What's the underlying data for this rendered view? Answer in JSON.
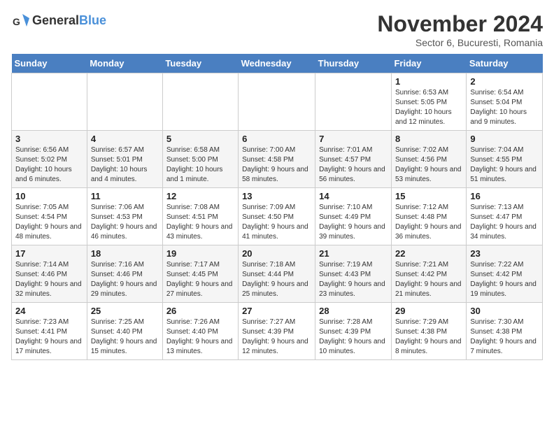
{
  "logo": {
    "line1": "General",
    "line2": "Blue"
  },
  "title": "November 2024",
  "subtitle": "Sector 6, Bucuresti, Romania",
  "days_of_week": [
    "Sunday",
    "Monday",
    "Tuesday",
    "Wednesday",
    "Thursday",
    "Friday",
    "Saturday"
  ],
  "weeks": [
    [
      {
        "day": "",
        "info": ""
      },
      {
        "day": "",
        "info": ""
      },
      {
        "day": "",
        "info": ""
      },
      {
        "day": "",
        "info": ""
      },
      {
        "day": "",
        "info": ""
      },
      {
        "day": "1",
        "info": "Sunrise: 6:53 AM\nSunset: 5:05 PM\nDaylight: 10 hours and 12 minutes."
      },
      {
        "day": "2",
        "info": "Sunrise: 6:54 AM\nSunset: 5:04 PM\nDaylight: 10 hours and 9 minutes."
      }
    ],
    [
      {
        "day": "3",
        "info": "Sunrise: 6:56 AM\nSunset: 5:02 PM\nDaylight: 10 hours and 6 minutes."
      },
      {
        "day": "4",
        "info": "Sunrise: 6:57 AM\nSunset: 5:01 PM\nDaylight: 10 hours and 4 minutes."
      },
      {
        "day": "5",
        "info": "Sunrise: 6:58 AM\nSunset: 5:00 PM\nDaylight: 10 hours and 1 minute."
      },
      {
        "day": "6",
        "info": "Sunrise: 7:00 AM\nSunset: 4:58 PM\nDaylight: 9 hours and 58 minutes."
      },
      {
        "day": "7",
        "info": "Sunrise: 7:01 AM\nSunset: 4:57 PM\nDaylight: 9 hours and 56 minutes."
      },
      {
        "day": "8",
        "info": "Sunrise: 7:02 AM\nSunset: 4:56 PM\nDaylight: 9 hours and 53 minutes."
      },
      {
        "day": "9",
        "info": "Sunrise: 7:04 AM\nSunset: 4:55 PM\nDaylight: 9 hours and 51 minutes."
      }
    ],
    [
      {
        "day": "10",
        "info": "Sunrise: 7:05 AM\nSunset: 4:54 PM\nDaylight: 9 hours and 48 minutes."
      },
      {
        "day": "11",
        "info": "Sunrise: 7:06 AM\nSunset: 4:53 PM\nDaylight: 9 hours and 46 minutes."
      },
      {
        "day": "12",
        "info": "Sunrise: 7:08 AM\nSunset: 4:51 PM\nDaylight: 9 hours and 43 minutes."
      },
      {
        "day": "13",
        "info": "Sunrise: 7:09 AM\nSunset: 4:50 PM\nDaylight: 9 hours and 41 minutes."
      },
      {
        "day": "14",
        "info": "Sunrise: 7:10 AM\nSunset: 4:49 PM\nDaylight: 9 hours and 39 minutes."
      },
      {
        "day": "15",
        "info": "Sunrise: 7:12 AM\nSunset: 4:48 PM\nDaylight: 9 hours and 36 minutes."
      },
      {
        "day": "16",
        "info": "Sunrise: 7:13 AM\nSunset: 4:47 PM\nDaylight: 9 hours and 34 minutes."
      }
    ],
    [
      {
        "day": "17",
        "info": "Sunrise: 7:14 AM\nSunset: 4:46 PM\nDaylight: 9 hours and 32 minutes."
      },
      {
        "day": "18",
        "info": "Sunrise: 7:16 AM\nSunset: 4:46 PM\nDaylight: 9 hours and 29 minutes."
      },
      {
        "day": "19",
        "info": "Sunrise: 7:17 AM\nSunset: 4:45 PM\nDaylight: 9 hours and 27 minutes."
      },
      {
        "day": "20",
        "info": "Sunrise: 7:18 AM\nSunset: 4:44 PM\nDaylight: 9 hours and 25 minutes."
      },
      {
        "day": "21",
        "info": "Sunrise: 7:19 AM\nSunset: 4:43 PM\nDaylight: 9 hours and 23 minutes."
      },
      {
        "day": "22",
        "info": "Sunrise: 7:21 AM\nSunset: 4:42 PM\nDaylight: 9 hours and 21 minutes."
      },
      {
        "day": "23",
        "info": "Sunrise: 7:22 AM\nSunset: 4:42 PM\nDaylight: 9 hours and 19 minutes."
      }
    ],
    [
      {
        "day": "24",
        "info": "Sunrise: 7:23 AM\nSunset: 4:41 PM\nDaylight: 9 hours and 17 minutes."
      },
      {
        "day": "25",
        "info": "Sunrise: 7:25 AM\nSunset: 4:40 PM\nDaylight: 9 hours and 15 minutes."
      },
      {
        "day": "26",
        "info": "Sunrise: 7:26 AM\nSunset: 4:40 PM\nDaylight: 9 hours and 13 minutes."
      },
      {
        "day": "27",
        "info": "Sunrise: 7:27 AM\nSunset: 4:39 PM\nDaylight: 9 hours and 12 minutes."
      },
      {
        "day": "28",
        "info": "Sunrise: 7:28 AM\nSunset: 4:39 PM\nDaylight: 9 hours and 10 minutes."
      },
      {
        "day": "29",
        "info": "Sunrise: 7:29 AM\nSunset: 4:38 PM\nDaylight: 9 hours and 8 minutes."
      },
      {
        "day": "30",
        "info": "Sunrise: 7:30 AM\nSunset: 4:38 PM\nDaylight: 9 hours and 7 minutes."
      }
    ]
  ]
}
